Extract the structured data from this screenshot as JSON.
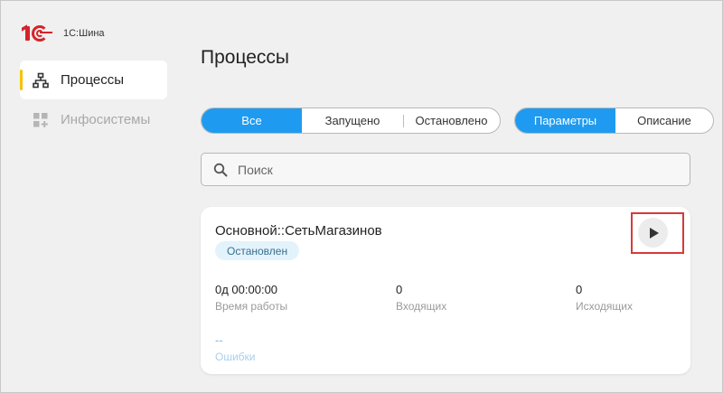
{
  "app": {
    "brand": "1С:Шина"
  },
  "sidebar": {
    "items": [
      {
        "label": "Процессы",
        "icon": "hierarchy-icon",
        "active": true
      },
      {
        "label": "Инфосистемы",
        "icon": "apps-add-icon",
        "active": false
      }
    ]
  },
  "page": {
    "title": "Процессы"
  },
  "filters": {
    "status": [
      "Все",
      "Запущено",
      "Остановлено"
    ],
    "status_selected": "Все",
    "view": [
      "Параметры",
      "Описание"
    ],
    "view_selected": "Параметры"
  },
  "search": {
    "placeholder": "Поиск",
    "value": ""
  },
  "process": {
    "name": "Основной::СетьМагазинов",
    "status": "Остановлен",
    "stats": [
      {
        "value": "0д 00:00:00",
        "label": "Время работы"
      },
      {
        "value": "0",
        "label": "Входящих"
      },
      {
        "value": "0",
        "label": "Исходящих"
      }
    ],
    "errors": {
      "value": "--",
      "label": "Ошибки"
    }
  },
  "colors": {
    "accent": "#1e9bf0",
    "brand_red": "#d6232a",
    "active_marker": "#f5c400",
    "highlight_box": "#d63a3a",
    "badge_bg": "#e3f3fc"
  }
}
